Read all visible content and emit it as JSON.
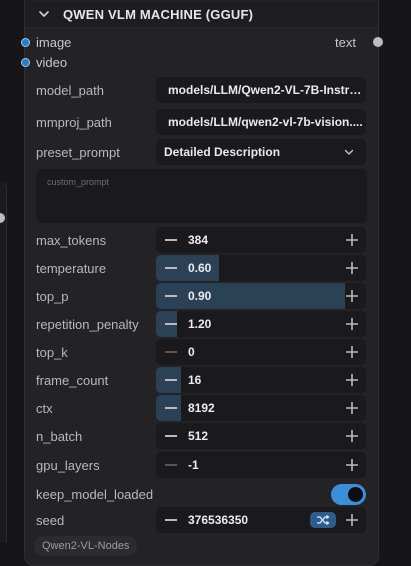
{
  "node": {
    "title": "QWEN VLM MACHINE (GGUF)",
    "inputs": [
      {
        "label": "image",
        "color": "#2b7cc6"
      },
      {
        "label": "video",
        "color": "#2b7cc6"
      }
    ],
    "output": {
      "label": "text"
    },
    "source_badge": "Qwen2-VL-Nodes"
  },
  "widgets": {
    "model_path": {
      "label": "model_path",
      "value": "models/LLM/Qwen2-VL-7B-Instru..."
    },
    "mmproj_path": {
      "label": "mmproj_path",
      "value": "models/LLM/qwen2-vl-7b-vision...."
    },
    "preset_prompt": {
      "label": "preset_prompt",
      "value": "Detailed Description"
    },
    "custom_prompt": {
      "placeholder": "custom_prompt"
    },
    "numbers": [
      {
        "key": "max_tokens",
        "label": "max_tokens",
        "value": "384",
        "fill": 0
      },
      {
        "key": "temperature",
        "label": "temperature",
        "value": "0.60",
        "fill": 0.3
      },
      {
        "key": "top_p",
        "label": "top_p",
        "value": "0.90",
        "fill": 0.9
      },
      {
        "key": "repetition_penalty",
        "label": "repetition_penalty",
        "value": "1.20",
        "fill": 0.1
      },
      {
        "key": "top_k",
        "label": "top_k",
        "value": "0",
        "fill": 0
      },
      {
        "key": "frame_count",
        "label": "frame_count",
        "value": "16",
        "fill": 0.12
      },
      {
        "key": "ctx",
        "label": "ctx",
        "value": "8192",
        "fill": 0.12
      },
      {
        "key": "n_batch",
        "label": "n_batch",
        "value": "512",
        "fill": 0
      },
      {
        "key": "gpu_layers",
        "label": "gpu_layers",
        "value": "-1",
        "fill": 0
      }
    ],
    "keep_model_loaded": {
      "label": "keep_model_loaded",
      "value": true
    },
    "seed": {
      "label": "seed",
      "value": "376536350",
      "control": "shuffle-icon"
    }
  },
  "colors": {
    "accent": "#3b8ed8",
    "slot_blue": "#2b7cc6",
    "fill": "#2a4156"
  }
}
